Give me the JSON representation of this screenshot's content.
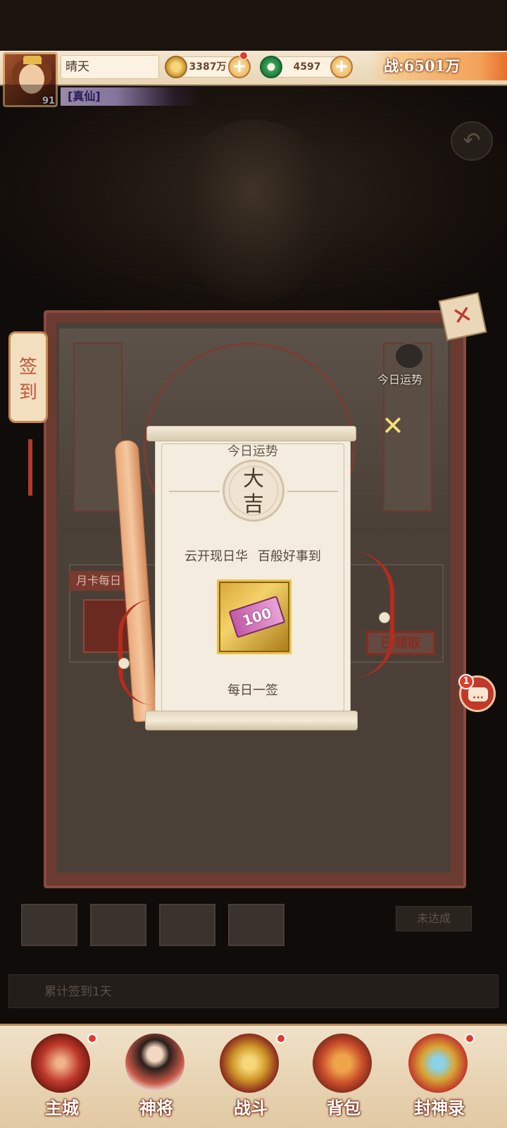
{
  "player": {
    "name": "晴天",
    "level": "91",
    "title": "[真仙]"
  },
  "resources": {
    "coins": "3387万",
    "jade": "4597",
    "power": "战:6501万"
  },
  "side_tab": {
    "label_top": "签",
    "label_bottom": "到"
  },
  "seal": "✕",
  "panel": {
    "fortune_label": "今日运势",
    "monthly_card_title": "月卡每日",
    "claimed_label": "已领取",
    "not_reached_label": "未达成",
    "cumulative_label": "累计签到1天"
  },
  "chat": {
    "badge": "1"
  },
  "popup": {
    "title": "今日运势",
    "luck_top": "大",
    "luck_bottom": "吉",
    "poem": "云开现日华 百般好事到",
    "reward_amount": "100",
    "reward_name": "每日一签"
  },
  "nav": {
    "items": [
      {
        "label": "主城",
        "icon": "city-gate-icon"
      },
      {
        "label": "神将",
        "icon": "hero-portrait-icon"
      },
      {
        "label": "战斗",
        "icon": "crossed-swords-icon"
      },
      {
        "label": "背包",
        "icon": "bag-icon"
      },
      {
        "label": "封神录",
        "icon": "record-book-icon"
      }
    ]
  },
  "colors": {
    "accent_red": "#c0392b",
    "parchment": "#f3ecdf",
    "gold": "#e9c24a"
  }
}
